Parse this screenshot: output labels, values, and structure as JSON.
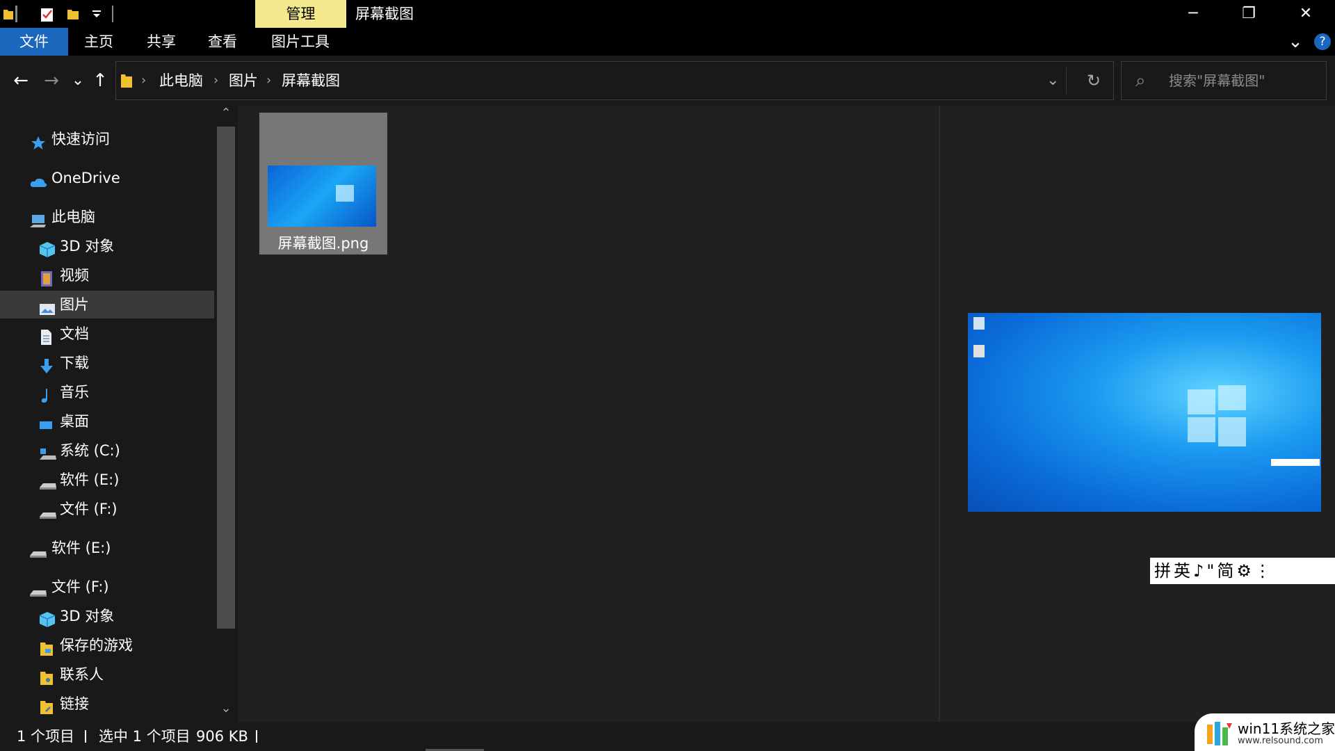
{
  "window": {
    "manage_tab": "管理",
    "title": "屏幕截图",
    "minimize": "─",
    "restore": "❐",
    "close": "✕"
  },
  "ribbon": {
    "tabs": [
      "文件",
      "主页",
      "共享",
      "查看",
      "图片工具"
    ],
    "expand": "⌄",
    "help": "?"
  },
  "navigation": {
    "back": "←",
    "forward": "→",
    "recent": "⌄",
    "up": "↑"
  },
  "address": {
    "crumbs": [
      "此电脑",
      "图片",
      "屏幕截图"
    ],
    "separator": "›",
    "dropdown": "⌄",
    "refresh": "↻"
  },
  "search": {
    "icon": "⌕",
    "placeholder": "搜索\"屏幕截图\""
  },
  "nav_pane": {
    "items": [
      {
        "label": "快速访问",
        "icon": "star-icon"
      },
      {
        "label": "OneDrive",
        "icon": "cloud-icon"
      },
      {
        "label": "此电脑",
        "icon": "computer-icon"
      },
      {
        "label": "3D 对象",
        "icon": "cube-icon"
      },
      {
        "label": "视频",
        "icon": "video-icon"
      },
      {
        "label": "图片",
        "icon": "picture-icon",
        "selected": true
      },
      {
        "label": "文档",
        "icon": "document-icon"
      },
      {
        "label": "下载",
        "icon": "download-icon"
      },
      {
        "label": "音乐",
        "icon": "music-icon"
      },
      {
        "label": "桌面",
        "icon": "desktop-icon"
      },
      {
        "label": "系统 (C:)",
        "icon": "system-drive-icon"
      },
      {
        "label": "软件 (E:)",
        "icon": "drive-icon"
      },
      {
        "label": "文件 (F:)",
        "icon": "drive-icon"
      },
      {
        "label": "软件 (E:)",
        "icon": "drive-icon"
      },
      {
        "label": "文件 (F:)",
        "icon": "drive-icon"
      },
      {
        "label": "3D 对象",
        "icon": "cube-icon"
      },
      {
        "label": "保存的游戏",
        "icon": "folder-icon"
      },
      {
        "label": "联系人",
        "icon": "folder-icon"
      },
      {
        "label": "链接",
        "icon": "folder-icon"
      }
    ],
    "scroll_up": "⌃",
    "scroll_down": "⌄"
  },
  "files": [
    {
      "name": "屏幕截图.png"
    }
  ],
  "preview": {
    "ime_toolbar": "拼英♪\"简⚙⋮"
  },
  "status": {
    "item_count": "1 个项目",
    "selected": "选中 1 个项目",
    "size": "906 KB"
  },
  "watermark": {
    "line1": "win11系统之家",
    "line2": "www.relsound.com"
  },
  "colors": {
    "file_tab": "#1b67be",
    "manage_tab": "#f5e98e",
    "background": "#202020",
    "selection": "#3a3a3a"
  }
}
